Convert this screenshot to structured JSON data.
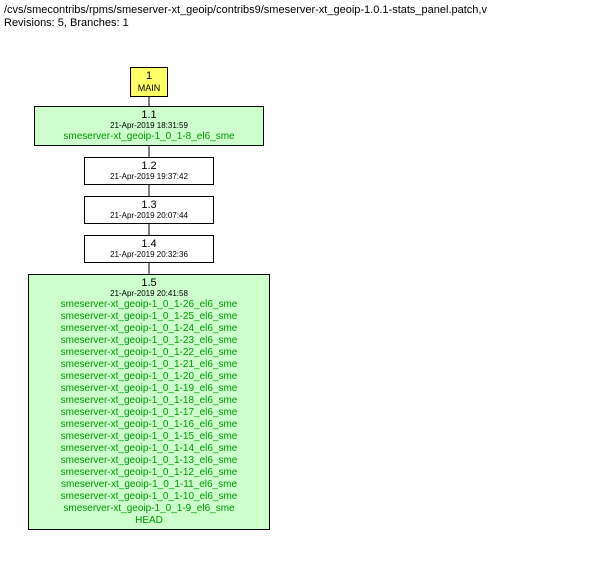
{
  "header": {
    "path": "/cvs/smecontribs/rpms/smeserver-xt_geoip/contribs9/smeserver-xt_geoip-1.0.1-stats_panel.patch,v",
    "stats": "Revisions: 5, Branches: 1"
  },
  "nodes": {
    "main": {
      "version": "1",
      "branch": "MAIN"
    },
    "r11": {
      "version": "1.1",
      "date": "21-Apr-2019 18:31:59",
      "tags": [
        "smeserver-xt_geoip-1_0_1-8_el6_sme"
      ]
    },
    "r12": {
      "version": "1.2",
      "date": "21-Apr-2019 19:37:42"
    },
    "r13": {
      "version": "1.3",
      "date": "21-Apr-2019 20:07:44"
    },
    "r14": {
      "version": "1.4",
      "date": "21-Apr-2019 20:32:36"
    },
    "r15": {
      "version": "1.5",
      "date": "21-Apr-2019 20:41:58",
      "tags": [
        "smeserver-xt_geoip-1_0_1-26_el6_sme",
        "smeserver-xt_geoip-1_0_1-25_el6_sme",
        "smeserver-xt_geoip-1_0_1-24_el6_sme",
        "smeserver-xt_geoip-1_0_1-23_el6_sme",
        "smeserver-xt_geoip-1_0_1-22_el6_sme",
        "smeserver-xt_geoip-1_0_1-21_el6_sme",
        "smeserver-xt_geoip-1_0_1-20_el6_sme",
        "smeserver-xt_geoip-1_0_1-19_el6_sme",
        "smeserver-xt_geoip-1_0_1-18_el6_sme",
        "smeserver-xt_geoip-1_0_1-17_el6_sme",
        "smeserver-xt_geoip-1_0_1-16_el6_sme",
        "smeserver-xt_geoip-1_0_1-15_el6_sme",
        "smeserver-xt_geoip-1_0_1-14_el6_sme",
        "smeserver-xt_geoip-1_0_1-13_el6_sme",
        "smeserver-xt_geoip-1_0_1-12_el6_sme",
        "smeserver-xt_geoip-1_0_1-11_el6_sme",
        "smeserver-xt_geoip-1_0_1-10_el6_sme",
        "smeserver-xt_geoip-1_0_1-9_el6_sme",
        "HEAD"
      ]
    }
  }
}
